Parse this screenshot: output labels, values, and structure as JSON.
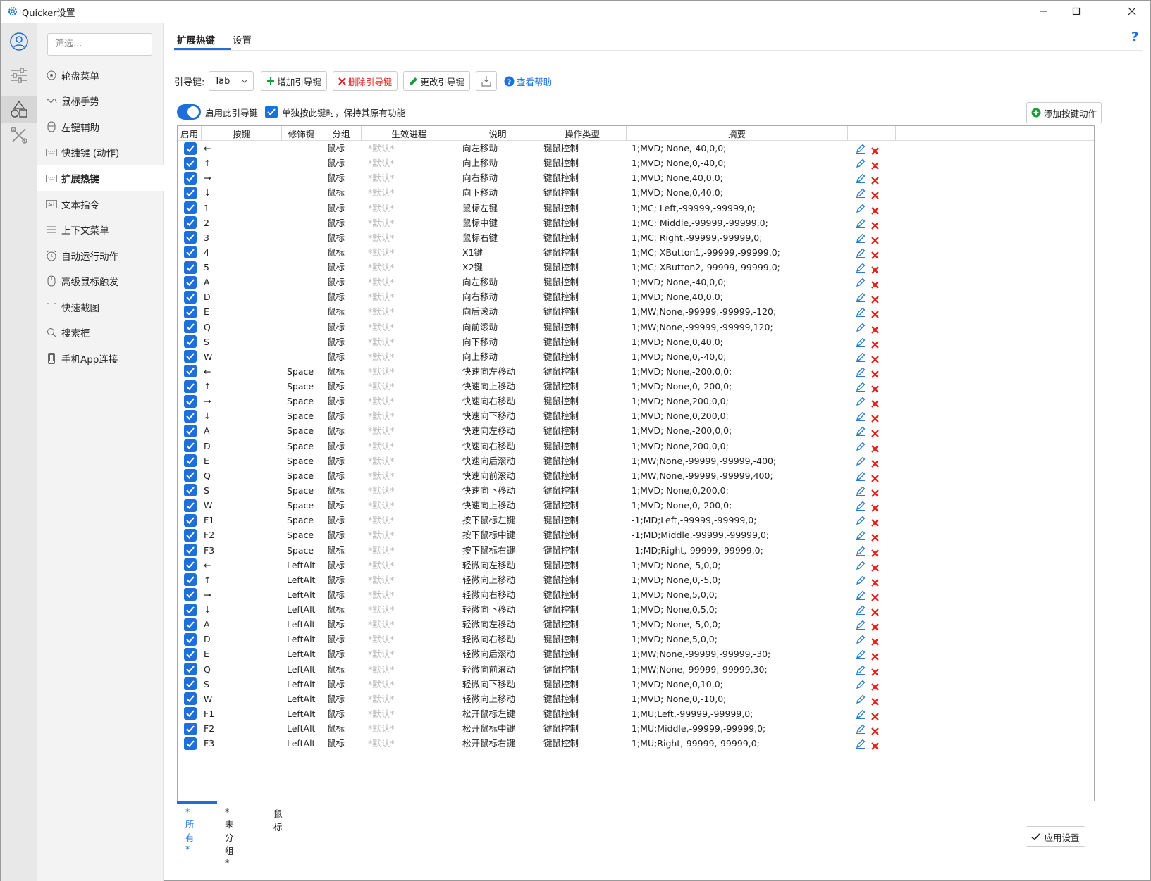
{
  "window": {
    "title": "Quicker设置"
  },
  "sidebar": {
    "filter_placeholder": "筛选...",
    "items": [
      {
        "label": "轮盘菜单",
        "icon": "wheel-icon"
      },
      {
        "label": "鼠标手势",
        "icon": "gesture-icon"
      },
      {
        "label": "左键辅助",
        "icon": "mouse-left-icon"
      },
      {
        "label": "快捷键 (动作)",
        "icon": "keyboard-icon"
      },
      {
        "label": "扩展热键",
        "icon": "keyboard-icon",
        "selected": true
      },
      {
        "label": "文本指令",
        "icon": "text-ad-icon"
      },
      {
        "label": "上下文菜单",
        "icon": "menu-lines-icon"
      },
      {
        "label": "自动运行动作",
        "icon": "alarm-icon"
      },
      {
        "label": "高级鼠标触发",
        "icon": "mouse-icon"
      },
      {
        "label": "快速截图",
        "icon": "screenshot-icon"
      },
      {
        "label": "搜索框",
        "icon": "search-icon"
      },
      {
        "label": "手机App连接",
        "icon": "phone-icon"
      }
    ]
  },
  "tabs": {
    "active": "扩展热键",
    "settings": "设置"
  },
  "toolbar": {
    "leader_label": "引导键:",
    "leader_value": "Tab",
    "add_leader": "增加引导键",
    "delete_leader": "删除引导键",
    "change_leader": "更改引导键",
    "help": "查看帮助"
  },
  "options": {
    "enable_leader": "启用此引导键",
    "keep_original": "单独按此键时，保持其原有功能",
    "add_action": "添加按键动作"
  },
  "columns": [
    "启用",
    "按键",
    "修饰键",
    "分组",
    "生效进程",
    "说明",
    "操作类型",
    "摘要"
  ],
  "rows": [
    {
      "key": "←",
      "mod": "",
      "group": "鼠标",
      "proc": "*默认*",
      "desc": "向左移动",
      "type": "键鼠控制",
      "summary": "1;MVD; None,-40,0,0;"
    },
    {
      "key": "↑",
      "mod": "",
      "group": "鼠标",
      "proc": "*默认*",
      "desc": "向上移动",
      "type": "键鼠控制",
      "summary": "1;MVD; None,0,-40,0;"
    },
    {
      "key": "→",
      "mod": "",
      "group": "鼠标",
      "proc": "*默认*",
      "desc": "向右移动",
      "type": "键鼠控制",
      "summary": "1;MVD; None,40,0,0;"
    },
    {
      "key": "↓",
      "mod": "",
      "group": "鼠标",
      "proc": "*默认*",
      "desc": "向下移动",
      "type": "键鼠控制",
      "summary": "1;MVD; None,0,40,0;"
    },
    {
      "key": "1",
      "mod": "",
      "group": "鼠标",
      "proc": "*默认*",
      "desc": "鼠标左键",
      "type": "键鼠控制",
      "summary": "1;MC; Left,-99999,-99999,0;"
    },
    {
      "key": "2",
      "mod": "",
      "group": "鼠标",
      "proc": "*默认*",
      "desc": "鼠标中键",
      "type": "键鼠控制",
      "summary": "1;MC; Middle,-99999,-99999,0;"
    },
    {
      "key": "3",
      "mod": "",
      "group": "鼠标",
      "proc": "*默认*",
      "desc": "鼠标右键",
      "type": "键鼠控制",
      "summary": "1;MC; Right,-99999,-99999,0;"
    },
    {
      "key": "4",
      "mod": "",
      "group": "鼠标",
      "proc": "*默认*",
      "desc": "X1键",
      "type": "键鼠控制",
      "summary": "1;MC; XButton1,-99999,-99999,0;"
    },
    {
      "key": "5",
      "mod": "",
      "group": "鼠标",
      "proc": "*默认*",
      "desc": "X2键",
      "type": "键鼠控制",
      "summary": "1;MC; XButton2,-99999,-99999,0;"
    },
    {
      "key": "A",
      "mod": "",
      "group": "鼠标",
      "proc": "*默认*",
      "desc": "向左移动",
      "type": "键鼠控制",
      "summary": "1;MVD; None,-40,0,0;"
    },
    {
      "key": "D",
      "mod": "",
      "group": "鼠标",
      "proc": "*默认*",
      "desc": "向右移动",
      "type": "键鼠控制",
      "summary": "1;MVD; None,40,0,0;"
    },
    {
      "key": "E",
      "mod": "",
      "group": "鼠标",
      "proc": "*默认*",
      "desc": "向后滚动",
      "type": "键鼠控制",
      "summary": "1;MW;None,-99999,-99999,-120;"
    },
    {
      "key": "Q",
      "mod": "",
      "group": "鼠标",
      "proc": "*默认*",
      "desc": "向前滚动",
      "type": "键鼠控制",
      "summary": "1;MW;None,-99999,-99999,120;"
    },
    {
      "key": "S",
      "mod": "",
      "group": "鼠标",
      "proc": "*默认*",
      "desc": "向下移动",
      "type": "键鼠控制",
      "summary": "1;MVD; None,0,40,0;"
    },
    {
      "key": "W",
      "mod": "",
      "group": "鼠标",
      "proc": "*默认*",
      "desc": "向上移动",
      "type": "键鼠控制",
      "summary": "1;MVD; None,0,-40,0;"
    },
    {
      "key": "←",
      "mod": "Space",
      "group": "鼠标",
      "proc": "*默认*",
      "desc": "快速向左移动",
      "type": "键鼠控制",
      "summary": "1;MVD; None,-200,0,0;"
    },
    {
      "key": "↑",
      "mod": "Space",
      "group": "鼠标",
      "proc": "*默认*",
      "desc": "快速向上移动",
      "type": "键鼠控制",
      "summary": "1;MVD; None,0,-200,0;"
    },
    {
      "key": "→",
      "mod": "Space",
      "group": "鼠标",
      "proc": "*默认*",
      "desc": "快速向右移动",
      "type": "键鼠控制",
      "summary": "1;MVD; None,200,0,0;"
    },
    {
      "key": "↓",
      "mod": "Space",
      "group": "鼠标",
      "proc": "*默认*",
      "desc": "快速向下移动",
      "type": "键鼠控制",
      "summary": "1;MVD; None,0,200,0;"
    },
    {
      "key": "A",
      "mod": "Space",
      "group": "鼠标",
      "proc": "*默认*",
      "desc": "快速向左移动",
      "type": "键鼠控制",
      "summary": "1;MVD; None,-200,0,0;"
    },
    {
      "key": "D",
      "mod": "Space",
      "group": "鼠标",
      "proc": "*默认*",
      "desc": "快速向右移动",
      "type": "键鼠控制",
      "summary": "1;MVD; None,200,0,0;"
    },
    {
      "key": "E",
      "mod": "Space",
      "group": "鼠标",
      "proc": "*默认*",
      "desc": "快速向后滚动",
      "type": "键鼠控制",
      "summary": "1;MW;None,-99999,-99999,-400;"
    },
    {
      "key": "Q",
      "mod": "Space",
      "group": "鼠标",
      "proc": "*默认*",
      "desc": "快速向前滚动",
      "type": "键鼠控制",
      "summary": "1;MW;None,-99999,-99999,400;"
    },
    {
      "key": "S",
      "mod": "Space",
      "group": "鼠标",
      "proc": "*默认*",
      "desc": "快速向下移动",
      "type": "键鼠控制",
      "summary": "1;MVD; None,0,200,0;"
    },
    {
      "key": "W",
      "mod": "Space",
      "group": "鼠标",
      "proc": "*默认*",
      "desc": "快速向上移动",
      "type": "键鼠控制",
      "summary": "1;MVD; None,0,-200,0;"
    },
    {
      "key": "F1",
      "mod": "Space",
      "group": "鼠标",
      "proc": "*默认*",
      "desc": "按下鼠标左键",
      "type": "键鼠控制",
      "summary": "-1;MD;Left,-99999,-99999,0;"
    },
    {
      "key": "F2",
      "mod": "Space",
      "group": "鼠标",
      "proc": "*默认*",
      "desc": "按下鼠标中键",
      "type": "键鼠控制",
      "summary": "-1;MD;Middle,-99999,-99999,0;"
    },
    {
      "key": "F3",
      "mod": "Space",
      "group": "鼠标",
      "proc": "*默认*",
      "desc": "按下鼠标右键",
      "type": "键鼠控制",
      "summary": "-1;MD;Right,-99999,-99999,0;"
    },
    {
      "key": "←",
      "mod": "LeftAlt",
      "group": "鼠标",
      "proc": "*默认*",
      "desc": "轻微向左移动",
      "type": "键鼠控制",
      "summary": "1;MVD; None,-5,0,0;"
    },
    {
      "key": "↑",
      "mod": "LeftAlt",
      "group": "鼠标",
      "proc": "*默认*",
      "desc": "轻微向上移动",
      "type": "键鼠控制",
      "summary": "1;MVD; None,0,-5,0;"
    },
    {
      "key": "→",
      "mod": "LeftAlt",
      "group": "鼠标",
      "proc": "*默认*",
      "desc": "轻微向右移动",
      "type": "键鼠控制",
      "summary": "1;MVD; None,5,0,0;"
    },
    {
      "key": "↓",
      "mod": "LeftAlt",
      "group": "鼠标",
      "proc": "*默认*",
      "desc": "轻微向下移动",
      "type": "键鼠控制",
      "summary": "1;MVD; None,0,5,0;"
    },
    {
      "key": "A",
      "mod": "LeftAlt",
      "group": "鼠标",
      "proc": "*默认*",
      "desc": "轻微向左移动",
      "type": "键鼠控制",
      "summary": "1;MVD; None,-5,0,0;"
    },
    {
      "key": "D",
      "mod": "LeftAlt",
      "group": "鼠标",
      "proc": "*默认*",
      "desc": "轻微向右移动",
      "type": "键鼠控制",
      "summary": "1;MVD; None,5,0,0;"
    },
    {
      "key": "E",
      "mod": "LeftAlt",
      "group": "鼠标",
      "proc": "*默认*",
      "desc": "轻微向后滚动",
      "type": "键鼠控制",
      "summary": "1;MW;None,-99999,-99999,-30;"
    },
    {
      "key": "Q",
      "mod": "LeftAlt",
      "group": "鼠标",
      "proc": "*默认*",
      "desc": "轻微向前滚动",
      "type": "键鼠控制",
      "summary": "1;MW;None,-99999,-99999,30;"
    },
    {
      "key": "S",
      "mod": "LeftAlt",
      "group": "鼠标",
      "proc": "*默认*",
      "desc": "轻微向下移动",
      "type": "键鼠控制",
      "summary": "1;MVD; None,0,10,0;"
    },
    {
      "key": "W",
      "mod": "LeftAlt",
      "group": "鼠标",
      "proc": "*默认*",
      "desc": "轻微向上移动",
      "type": "键鼠控制",
      "summary": "1;MVD; None,0,-10,0;"
    },
    {
      "key": "F1",
      "mod": "LeftAlt",
      "group": "鼠标",
      "proc": "*默认*",
      "desc": "松开鼠标左键",
      "type": "键鼠控制",
      "summary": "1;MU;Left,-99999,-99999,0;"
    },
    {
      "key": "F2",
      "mod": "LeftAlt",
      "group": "鼠标",
      "proc": "*默认*",
      "desc": "松开鼠标中键",
      "type": "键鼠控制",
      "summary": "1;MU;Middle,-99999,-99999,0;"
    },
    {
      "key": "F3",
      "mod": "LeftAlt",
      "group": "鼠标",
      "proc": "*默认*",
      "desc": "松开鼠标右键",
      "type": "键鼠控制",
      "summary": "1;MU;Right,-99999,-99999,0;"
    }
  ],
  "group_tabs": [
    "*所有*",
    "*未分组*",
    "鼠标"
  ],
  "apply_label": "应用设置",
  "colors": {
    "accent": "#1e6fd9",
    "delete": "#e0201d",
    "add": "#1a9e3a"
  }
}
